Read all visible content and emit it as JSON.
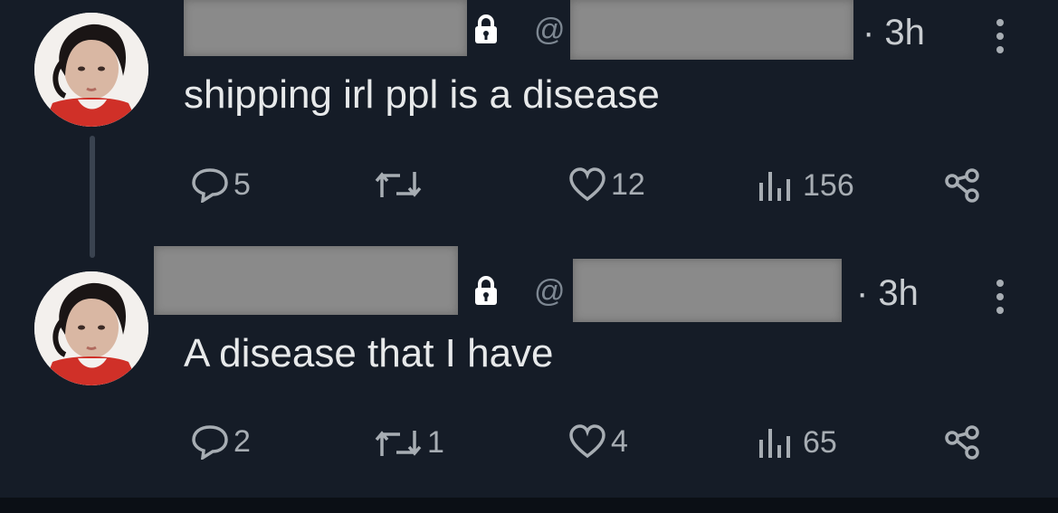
{
  "tweets": [
    {
      "time": "· 3h",
      "at": "@",
      "text": "shipping irl ppl is a disease",
      "replies": "5",
      "retweets": "",
      "likes": "12",
      "views": "156"
    },
    {
      "time": "· 3h",
      "at": "@",
      "text": "A disease that I have",
      "replies": "2",
      "retweets": "1",
      "likes": "4",
      "views": "65"
    }
  ],
  "colors": {
    "background": "#151c27",
    "text": "#e7e9ea",
    "muted": "#a7adb3",
    "redaction": "#8a8a8a"
  },
  "icons": [
    "lock-icon",
    "more-icon",
    "reply-icon",
    "retweet-icon",
    "like-icon",
    "views-icon",
    "share-icon"
  ]
}
